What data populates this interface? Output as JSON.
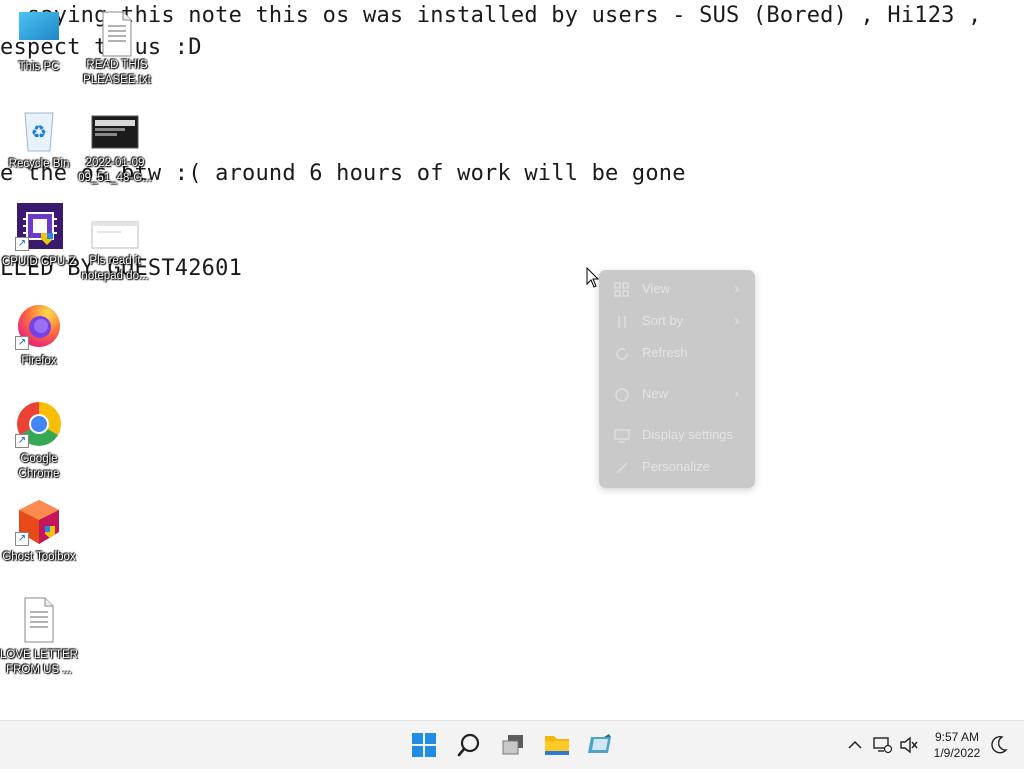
{
  "wallpaper": {
    "line1": "  saying this note this os was installed by users - SUS (Bored) , Hi123 ,",
    "line2": "espect to us :D",
    "line3": "e the os btw :( around 6 hours of work will be gone",
    "line4": "LLED BY GUEST42601"
  },
  "desktop": {
    "icons": [
      {
        "label": "This PC",
        "icon": "this-pc-icon"
      },
      {
        "label": "READ THIS PLEASEE.txt",
        "icon": "text-file-icon"
      },
      {
        "label": "Recycle Bin",
        "icon": "recycle-bin-icon"
      },
      {
        "label": "2022-01-09 09_51_48-G...",
        "icon": "screenshot-thumbnail-icon"
      },
      {
        "label": "CPUID CPU-Z",
        "icon": "cpuz-icon"
      },
      {
        "label": "Pls read it notepad do...",
        "icon": "notepad-doc-icon"
      },
      {
        "label": "Firefox",
        "icon": "firefox-icon"
      },
      {
        "label": "Google Chrome",
        "icon": "chrome-icon"
      },
      {
        "label": "Ghost Toolbox",
        "icon": "ghost-toolbox-icon"
      },
      {
        "label": "LOVE LETTER FROM US ...",
        "icon": "text-file-icon"
      }
    ]
  },
  "context_menu": {
    "items": [
      {
        "label": "View",
        "icon": "view-grid-icon",
        "submenu": true
      },
      {
        "label": "Sort by",
        "icon": "sort-icon",
        "submenu": true
      },
      {
        "label": "Refresh",
        "icon": "refresh-icon",
        "submenu": false
      },
      {
        "label": "New",
        "icon": "new-icon",
        "submenu": true
      },
      {
        "label": "Display settings",
        "icon": "display-icon",
        "submenu": false
      },
      {
        "label": "Personalize",
        "icon": "brush-icon",
        "submenu": false
      }
    ],
    "submenu_arrow": "›"
  },
  "taskbar": {
    "buttons": [
      "start-icon",
      "search-icon",
      "task-view-icon",
      "file-explorer-icon",
      "app-icon"
    ],
    "tray_icons": [
      "chevron-up-icon",
      "network-icon",
      "volume-muted-icon",
      "night-light-icon"
    ],
    "time": "9:57 AM",
    "date": "1/9/2022"
  },
  "colors": {
    "taskbar_bg": "#f3f3f3",
    "menu_bg": "#c9c9c9",
    "start_blue": "#1f8ce6"
  }
}
